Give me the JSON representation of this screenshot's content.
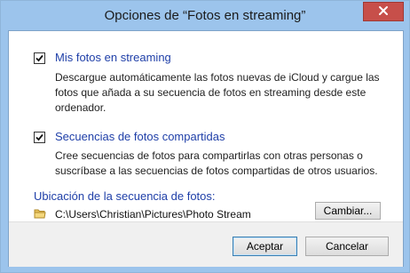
{
  "window": {
    "title": "Opciones de “Fotos en streaming”"
  },
  "options": [
    {
      "label": "Mis fotos en streaming",
      "checked": true,
      "description_lines": [
        "Descargue automáticamente las fotos nuevas de iCloud y cargue las",
        "fotos que añada a su secuencia de fotos en streaming desde este",
        "ordenador."
      ]
    },
    {
      "label": "Secuencias de fotos compartidas",
      "checked": true,
      "description_lines": [
        "Cree secuencias de fotos para compartirlas con otras personas o",
        "suscríbase a las secuencias de fotos compartidas de otros usuarios."
      ]
    }
  ],
  "location": {
    "heading": "Ubicación de la secuencia de fotos:",
    "path": "C:\\Users\\Christian\\Pictures\\Photo Stream",
    "change_label": "Cambiar..."
  },
  "footer": {
    "accept_label": "Aceptar",
    "cancel_label": "Cancelar"
  },
  "icons": {
    "close": "close-icon",
    "folder": "folder-icon",
    "checkmark": "checkmark-icon"
  }
}
